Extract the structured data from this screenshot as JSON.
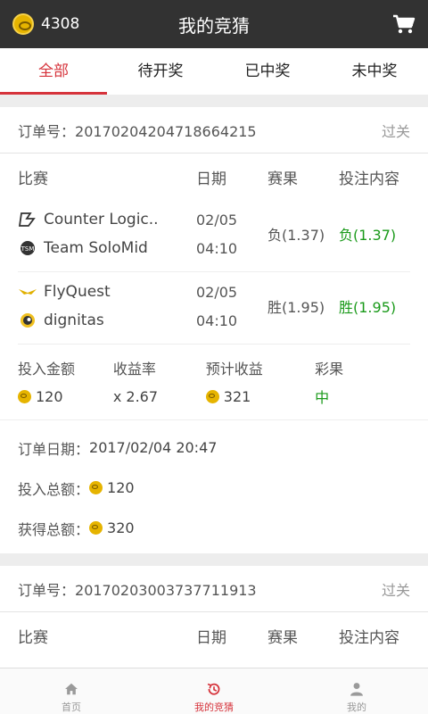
{
  "header": {
    "coin_balance": "4308",
    "title": "我的竞猜",
    "coin_icon": "coin-icon",
    "cart_icon": "cart-icon"
  },
  "tabs": [
    {
      "label": "全部",
      "active": true
    },
    {
      "label": "待开奖",
      "active": false
    },
    {
      "label": "已中奖",
      "active": false
    },
    {
      "label": "未中奖",
      "active": false
    }
  ],
  "columns": {
    "match": "比赛",
    "date": "日期",
    "result": "赛果",
    "bet": "投注内容"
  },
  "orders": [
    {
      "order_label": "订单号：",
      "order_no": "20170204204718664215",
      "type": "过关",
      "matches": [
        {
          "team1": "Counter Logic..",
          "team2": "Team SoloMid",
          "date": "02/05",
          "time": "04:10",
          "result": "负(1.37)",
          "bet": "负(1.37)"
        },
        {
          "team1": "FlyQuest",
          "team2": "dignitas",
          "date": "02/05",
          "time": "04:10",
          "result": "胜(1.95)",
          "bet": "胜(1.95)"
        }
      ],
      "stats": {
        "invest_label": "投入金额",
        "invest": "120",
        "rate_label": "收益率",
        "rate": "x 2.67",
        "expected_label": "预计收益",
        "expected": "321",
        "outcome_label": "彩果",
        "outcome": "中"
      },
      "summary": {
        "date_label": "订单日期：",
        "date": "2017/02/04 20:47",
        "total_invest_label": "投入总额：",
        "total_invest": "120",
        "total_gain_label": "获得总额：",
        "total_gain": "320"
      }
    },
    {
      "order_label": "订单号：",
      "order_no": "20170203003737711913",
      "type": "过关"
    }
  ],
  "bottom_nav": [
    {
      "icon": "home-icon",
      "label": "首页",
      "active": false
    },
    {
      "icon": "history-icon",
      "label": "我的竞猜",
      "active": true
    },
    {
      "icon": "user-icon",
      "label": "我的",
      "active": false
    }
  ],
  "colors": {
    "accent": "#d6333b",
    "win": "#1a9a1a",
    "topbar": "#323232",
    "coin": "#e6b400"
  }
}
